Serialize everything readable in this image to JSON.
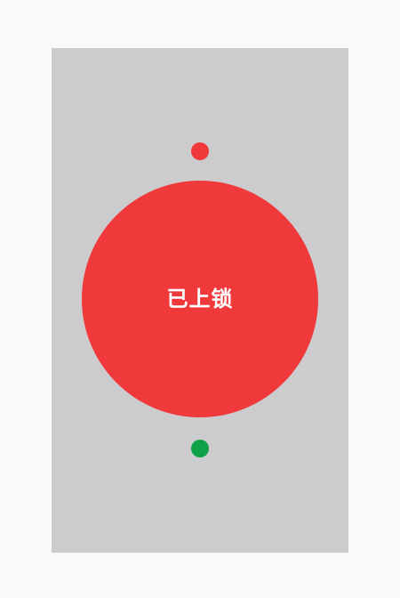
{
  "lock": {
    "status_label": "已上锁",
    "color": "#f0393b"
  },
  "indicators": {
    "top": {
      "color": "#f0393b"
    },
    "bottom": {
      "color": "#0da248"
    }
  },
  "colors": {
    "background": "#f9f8fb",
    "panel": "#cccbcd"
  }
}
